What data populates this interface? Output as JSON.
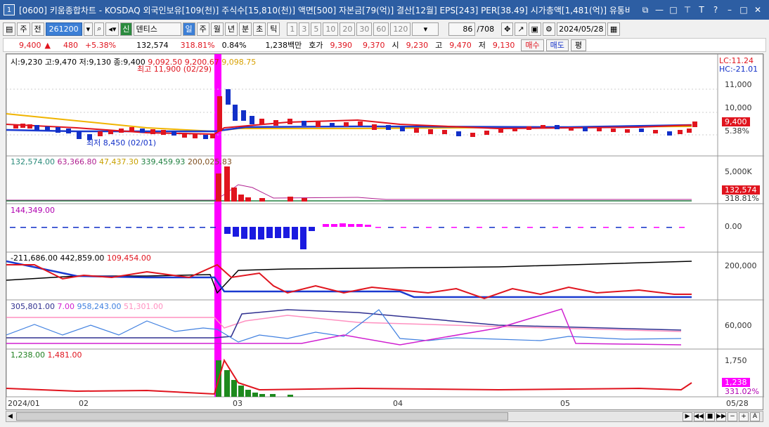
{
  "window": {
    "title": "[0600] 키움종합차트 - KOSDAQ 외국인보유[109(천)] 주식수[15,810(천)] 액면[500] 자본금[79(억)] 결산[12월] EPS[243] PER[38.49] 시가총액[1,481(억)] 유통비",
    "badge": "1"
  },
  "toolbar": {
    "period_btn": "주",
    "prev_btn": "전",
    "code": "261200",
    "stock_tag": "신",
    "stock_name": "덴티스",
    "views": [
      "일",
      "주",
      "월",
      "년",
      "분",
      "초",
      "틱"
    ],
    "active_view": "일",
    "intervals": [
      "1",
      "3",
      "5",
      "10",
      "20",
      "30",
      "60",
      "120"
    ],
    "count": "86",
    "total": "/708",
    "date": "2024/05/28"
  },
  "quote": {
    "price": "9,400",
    "arrow": "▲",
    "change": "480",
    "pct": "+5.38%",
    "volume": "132,574",
    "vol_ratio": "318.81%",
    "rate": "0.84%",
    "amount": "1,238백만",
    "bid_label": "호가",
    "ask": "9,390",
    "bid": "9,370",
    "open_label": "시",
    "open": "9,230",
    "high_label": "고",
    "high": "9,470",
    "low_label": "저",
    "low": "9,130",
    "buy": "매수",
    "sell": "매도",
    "avg": "평"
  },
  "panels": {
    "price": {
      "legend": "시:9,230 고:9,470 저:9,130 종:9,400",
      "ma": [
        "9,092.50",
        "9,200.67",
        "9,098.75"
      ],
      "max_note": "최고 11,900 (02/29)",
      "min_note": "최저 8,450 (02/01)",
      "lc": "LC:11.24",
      "hc": "HC:-21.01",
      "ticks": [
        "11,000",
        "10,000"
      ],
      "cur_price": "9,400",
      "cur_pct": "5.38%"
    },
    "volume": {
      "legend": [
        "132,574.00",
        "63,366.80",
        "47,437.30",
        "339,459.93",
        "200,025.83"
      ],
      "tick": "5,000K",
      "cur": "132,574",
      "pct": "318.81%"
    },
    "flow": {
      "legend": "144,349.00",
      "tick": "0.00"
    },
    "inst": {
      "legend": [
        "-211,686.00",
        "442,859.00",
        "109,454.00"
      ],
      "tick": "200,000"
    },
    "foreign": {
      "legend": [
        "305,801.00",
        "7.00",
        "958,243.00",
        "51,301.00"
      ],
      "tick": "60,000"
    },
    "amount": {
      "legend": [
        "1,238.00",
        "1,481.00"
      ],
      "tick": "1,750",
      "cur": "1,238",
      "pct": "331.02%"
    }
  },
  "xaxis": {
    "labels": [
      "2024/01",
      "02",
      "03",
      "04",
      "05"
    ],
    "end": "05/28"
  },
  "colors": {
    "up": "#e0141e",
    "down": "#1230c8",
    "accent": "#ff00ff",
    "ma_gold": "#f0b400",
    "title_bar": "#2d5ea3"
  }
}
